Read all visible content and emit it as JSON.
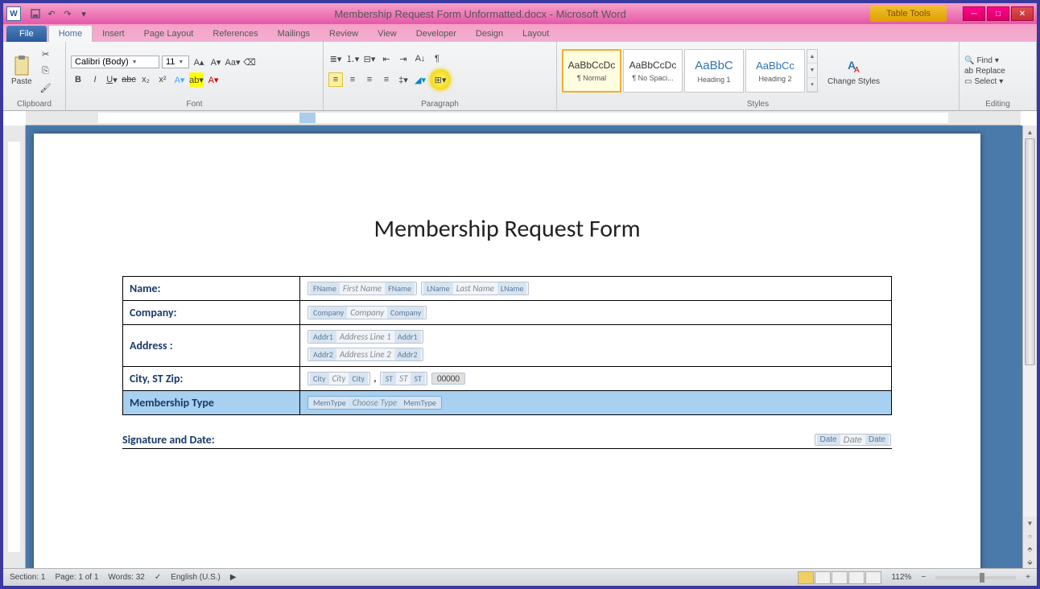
{
  "title": {
    "doc": "Membership Request Form Unformatted.docx",
    "app": "Microsoft Word",
    "context_tab": "Table Tools"
  },
  "tabs": {
    "file": "File",
    "list": [
      "Home",
      "Insert",
      "Page Layout",
      "References",
      "Mailings",
      "Review",
      "View",
      "Developer",
      "Design",
      "Layout"
    ],
    "active": "Home"
  },
  "ribbon": {
    "clipboard": {
      "label": "Clipboard",
      "paste": "Paste"
    },
    "font": {
      "label": "Font",
      "name": "Calibri (Body)",
      "size": "11"
    },
    "paragraph": {
      "label": "Paragraph"
    },
    "styles": {
      "label": "Styles",
      "change": "Change Styles",
      "items": [
        {
          "preview": "AaBbCcDc",
          "name": "¶ Normal"
        },
        {
          "preview": "AaBbCcDc",
          "name": "¶ No Spaci..."
        },
        {
          "preview": "AaBbC",
          "name": "Heading 1"
        },
        {
          "preview": "AaBbCc",
          "name": "Heading 2"
        }
      ]
    },
    "editing": {
      "label": "Editing",
      "find": "Find",
      "replace": "Replace",
      "select": "Select"
    }
  },
  "document": {
    "heading": "Membership Request Form",
    "rows": {
      "name": {
        "label": "Name:",
        "fname_tag": "FName",
        "fname_ph": "First Name",
        "lname_tag": "LName",
        "lname_ph": "Last Name"
      },
      "company": {
        "label": "Company:",
        "tag": "Company",
        "ph": "Company"
      },
      "address": {
        "label": "Address :",
        "a1_tag": "Addr1",
        "a1_ph": "Address Line 1",
        "a2_tag": "Addr2",
        "a2_ph": "Address Line 2"
      },
      "city": {
        "label": "City, ST Zip:",
        "city_tag": "City",
        "city_ph": "City",
        "st_tag": "ST",
        "st_ph": "ST",
        "zip_val": "00000",
        "comma": ","
      },
      "memtype": {
        "label": "Membership Type",
        "tag": "MemType",
        "ph": "Choose Type"
      }
    },
    "signature": {
      "label": "Signature and Date:",
      "date_tag": "Date",
      "date_ph": "Date"
    }
  },
  "status": {
    "section": "Section: 1",
    "page": "Page: 1 of 1",
    "words": "Words: 32",
    "lang": "English (U.S.)",
    "zoom": "112%"
  }
}
